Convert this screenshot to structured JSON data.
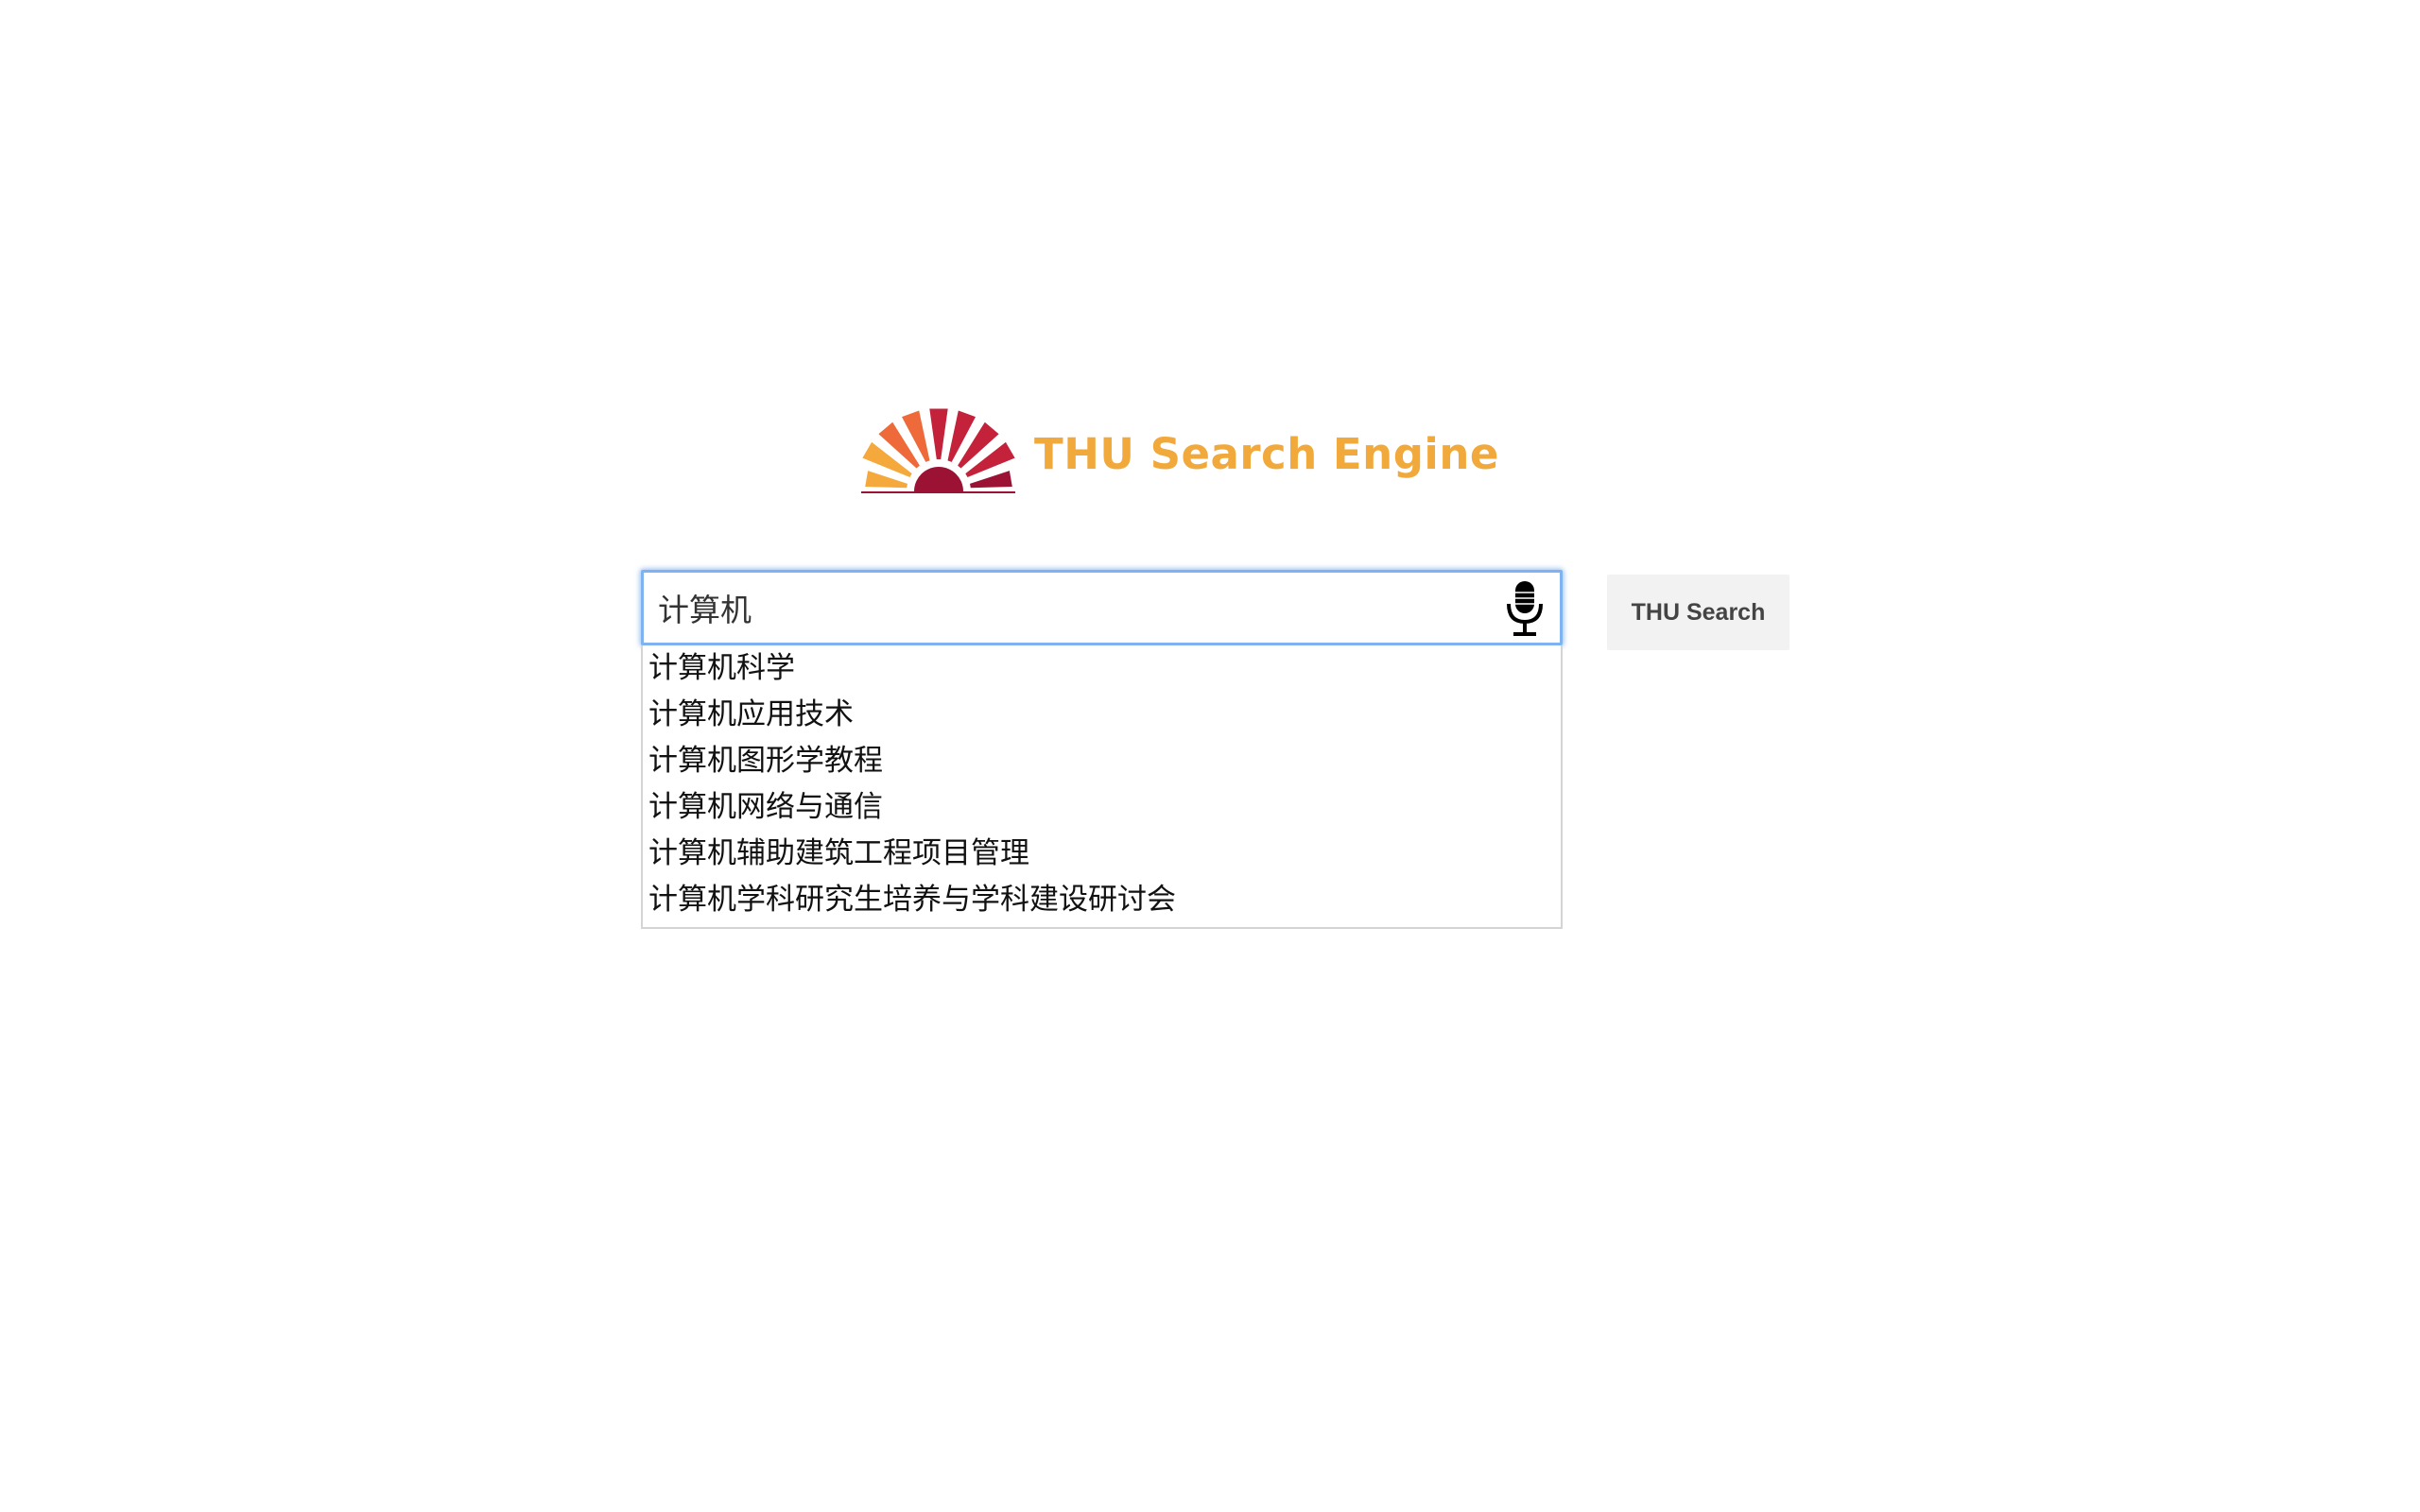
{
  "logo": {
    "text": "THU Search Engine",
    "icon": "sunburst-logo-icon",
    "colors": {
      "text": "#f2a93b",
      "ray_light": "#f5a93c",
      "ray_mid": "#ee6a3a",
      "ray_dark": "#c4213b",
      "ray_deep": "#9c1235"
    }
  },
  "search": {
    "value": "计算机",
    "mic_icon": "microphone-icon",
    "focus_color": "#7fb3f0"
  },
  "button": {
    "label": "THU Search"
  },
  "suggestions": [
    "计算机科学",
    "计算机应用技术",
    "计算机图形学教程",
    "计算机网络与通信",
    "计算机辅助建筑工程项目管理",
    "计算机学科研究生培养与学科建设研讨会"
  ]
}
